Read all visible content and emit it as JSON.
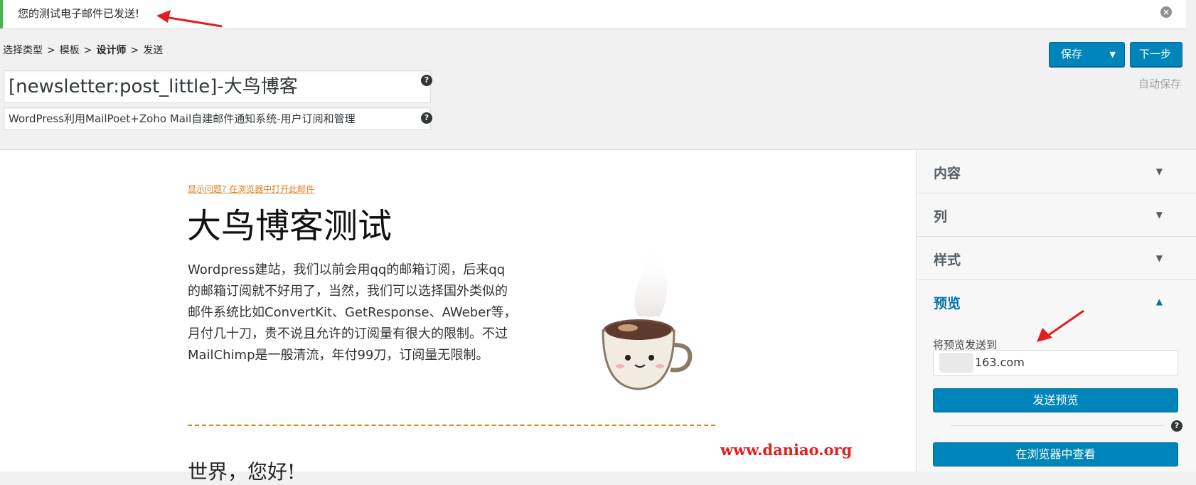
{
  "notice": {
    "message": "您的测试电子邮件已发送!"
  },
  "breadcrumb": {
    "items": [
      "选择类型",
      "模板",
      "设计师",
      "发送"
    ]
  },
  "toolbar": {
    "save_label": "保存",
    "next_label": "下一步",
    "autosave_label": "自动保存"
  },
  "form": {
    "subject": "[newsletter:post_little]-大鸟博客",
    "preheader": "WordPress利用MailPoet+Zoho Mail自建邮件通知系统-用户订阅和管理"
  },
  "email": {
    "view_in_browser": "显示问题? 在浏览器中打开此邮件",
    "heading": "大鸟博客测试",
    "body_lines": [
      "Wordpress建站，我们以前会用qq的邮箱订阅，后来qq",
      "的邮箱订阅就不好用了，当然，我们可以选择国外类似的",
      "邮件系统比如ConvertKit、GetResponse、AWeber等，",
      "月付几十刀，贵不说且允许的订阅量有很大的限制。不过",
      "MailChimp是一般清流，年付99刀，订阅量无限制。"
    ],
    "heading2": "世界，您好!",
    "watermark": "www.daniao.org"
  },
  "sidebar": {
    "sections": [
      {
        "title": "内容",
        "chevron": "▼"
      },
      {
        "title": "列",
        "chevron": "▼"
      },
      {
        "title": "样式",
        "chevron": "▼"
      },
      {
        "title": "预览",
        "chevron": "▲"
      }
    ],
    "preview": {
      "label": "将预览发送到",
      "email": "163.com",
      "send_button": "发送预览",
      "view_browser_button": "在浏览器中查看"
    }
  },
  "colors": {
    "primary": "#0085ba",
    "notice_border": "#46b450",
    "accent_orange": "#e67e22",
    "annotation_red": "#e02020"
  }
}
